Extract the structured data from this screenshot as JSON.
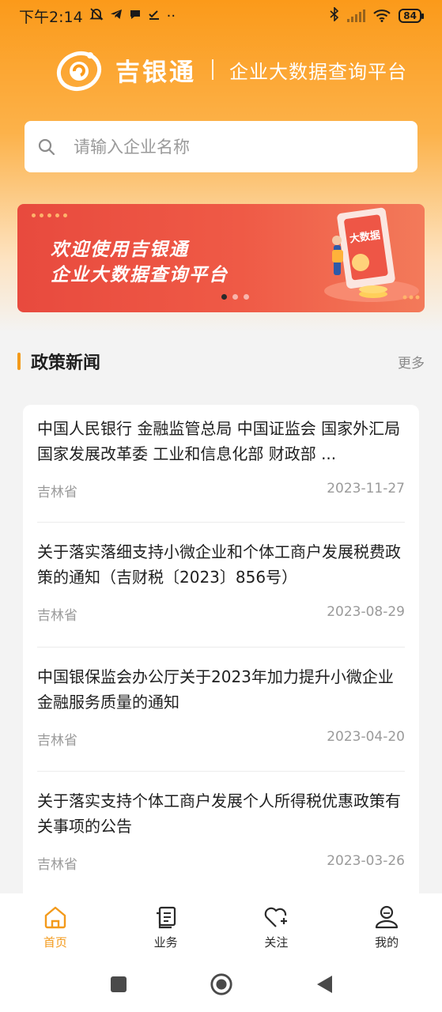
{
  "status_bar": {
    "time": "下午2:14",
    "extra": "··",
    "battery": "84"
  },
  "header": {
    "brand_name": "吉银通",
    "tagline": "企业大数据查询平台"
  },
  "search": {
    "placeholder": "请输入企业名称"
  },
  "banner": {
    "line1": "欢迎使用吉银通",
    "line2": "企业大数据查询平台",
    "art_label": "大数据",
    "pages": 3,
    "active_page": 1
  },
  "policy_section": {
    "title": "政策新闻",
    "more_label": "更多"
  },
  "news": [
    {
      "title": "中国人民银行 金融监管总局 中国证监会 国家外汇局 国家发展改革委 工业和信息化部 财政部 ...",
      "region": "吉林省",
      "date": "2023-11-27"
    },
    {
      "title": "关于落实落细支持小微企业和个体工商户发展税费政策的通知（吉财税〔2023〕856号）",
      "region": "吉林省",
      "date": "2023-08-29"
    },
    {
      "title": "中国银保监会办公厅关于2023年加力提升小微企业金融服务质量的通知",
      "region": "吉林省",
      "date": "2023-04-20"
    },
    {
      "title": "关于落实支持个体工商户发展个人所得税优惠政策有关事项的公告",
      "region": "吉林省",
      "date": "2023-03-26"
    }
  ],
  "bottom_nav": [
    {
      "label": "首页",
      "icon": "home-icon",
      "active": true
    },
    {
      "label": "业务",
      "icon": "business-icon",
      "active": false
    },
    {
      "label": "关注",
      "icon": "follow-heart-icon",
      "active": false
    },
    {
      "label": "我的",
      "icon": "profile-icon",
      "active": false
    }
  ],
  "colors": {
    "accent": "#f39a1b",
    "header_top": "#fb9a1a",
    "banner_red": "#e84a3e"
  }
}
